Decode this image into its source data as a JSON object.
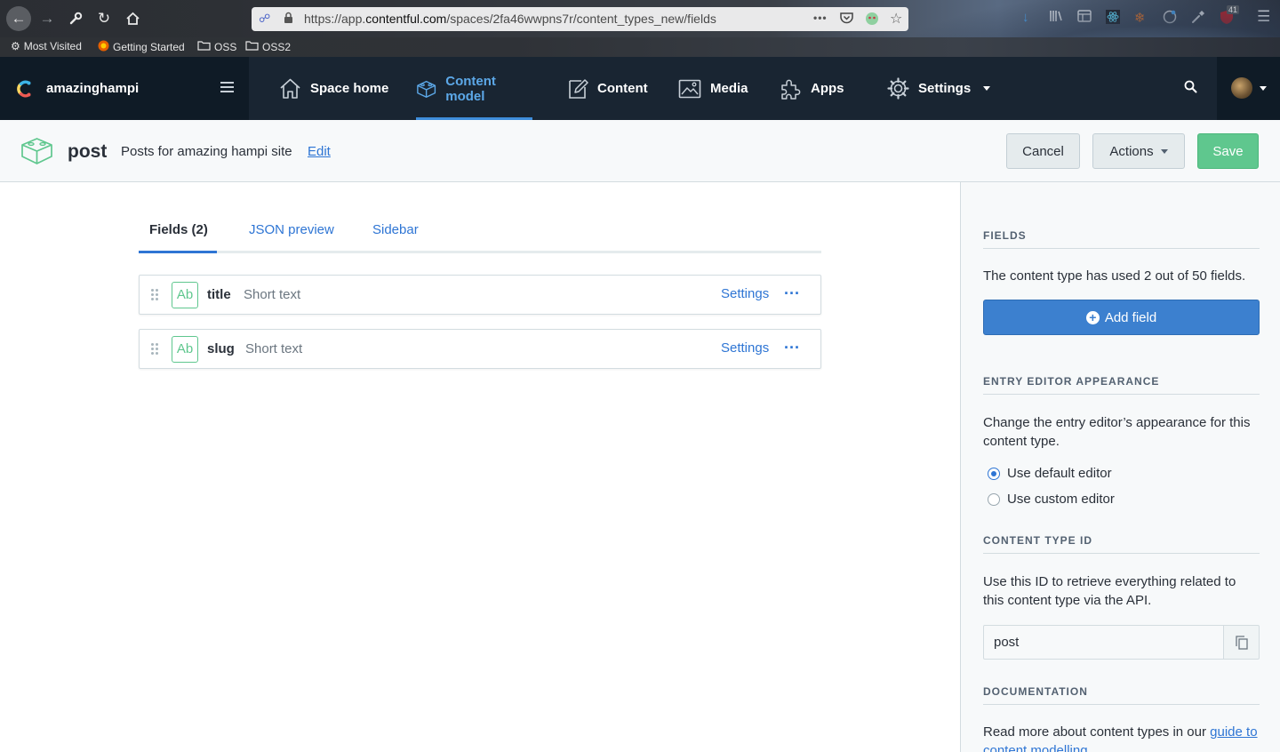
{
  "browser": {
    "url_prefix": "https://app.",
    "url_domain": "contentful.com",
    "url_path": "/spaces/2fa46wwpns7r/content_types_new/fields",
    "page_actions_label": "•••",
    "bookmarks": [
      "Most Visited",
      "Getting Started",
      "OSS",
      "OSS2"
    ],
    "badge_count": "41"
  },
  "app": {
    "space_name": "amazinghampi",
    "nav": [
      {
        "label": "Space home",
        "icon": "home-icon"
      },
      {
        "label": "Content model",
        "icon": "content-model-icon",
        "active": true
      },
      {
        "label": "Content",
        "icon": "content-icon"
      },
      {
        "label": "Media",
        "icon": "media-icon"
      },
      {
        "label": "Apps",
        "icon": "apps-icon"
      },
      {
        "label": "Settings",
        "icon": "settings-icon"
      }
    ]
  },
  "content_type": {
    "name": "post",
    "description": "Posts for amazing hampi site",
    "edit_label": "Edit",
    "cancel_label": "Cancel",
    "actions_label": "Actions",
    "save_label": "Save"
  },
  "tabs": [
    {
      "label": "Fields (2)",
      "active": true
    },
    {
      "label": "JSON preview"
    },
    {
      "label": "Sidebar"
    }
  ],
  "fields": [
    {
      "type_icon": "Ab",
      "name": "title",
      "type": "Short text",
      "settings_label": "Settings",
      "more_label": "···"
    },
    {
      "type_icon": "Ab",
      "name": "slug",
      "type": "Short text",
      "settings_label": "Settings",
      "more_label": "···"
    }
  ],
  "sidebar": {
    "fields_heading": "FIELDS",
    "fields_text": "The content type has used 2 out of 50 fields.",
    "add_field_label": "Add field",
    "appearance_heading": "ENTRY EDITOR APPEARANCE",
    "appearance_text": "Change the entry editor’s appearance for this content type.",
    "radio_default": "Use default editor",
    "radio_custom": "Use custom editor",
    "id_heading": "CONTENT TYPE ID",
    "id_text": "Use this ID to retrieve everything related to this content type via the API.",
    "id_value": "post",
    "doc_heading": "DOCUMENTATION",
    "doc_text": "Read more about content types in our ",
    "doc_link": "guide to content modelling"
  },
  "colors": {
    "nav_bg": "#192532",
    "accent_blue": "#2e75d4",
    "save_green": "#5fc78e",
    "field_icon_green": "#5fc78e"
  }
}
